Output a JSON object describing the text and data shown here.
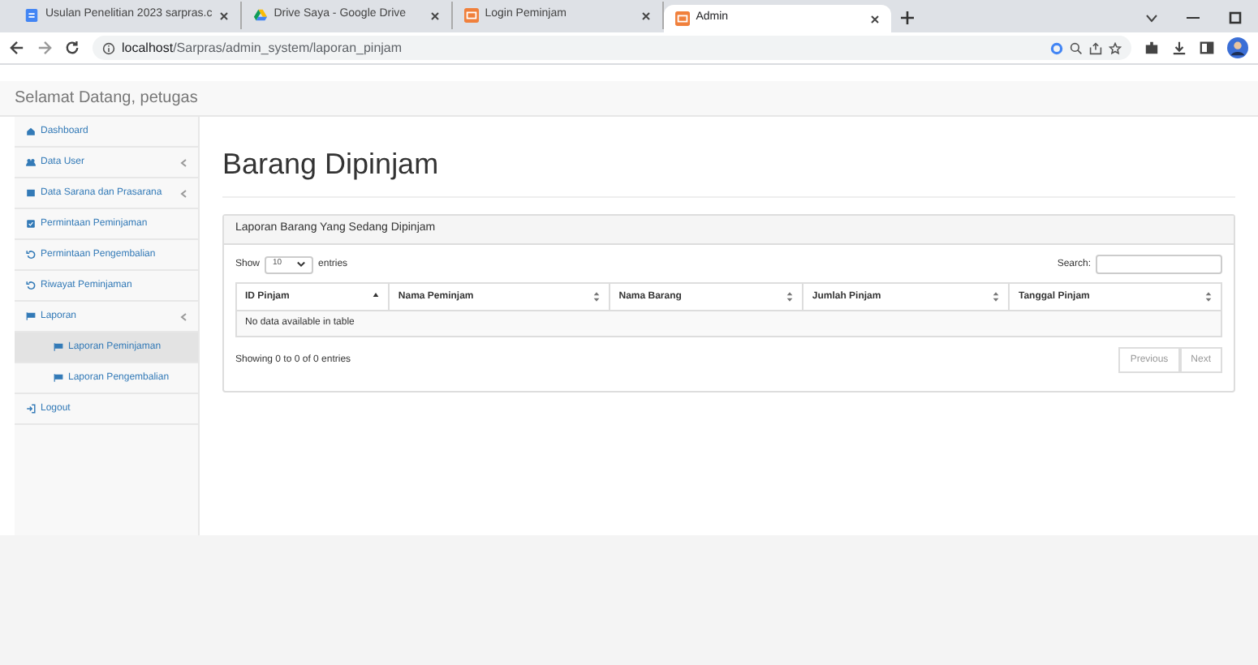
{
  "browser": {
    "tabs": [
      {
        "title": "Usulan Penelitian 2023 sarpras.c",
        "selected": false
      },
      {
        "title": "Drive Saya - Google Drive",
        "selected": false
      },
      {
        "title": "Login Peminjam",
        "selected": false
      },
      {
        "title": "Admin",
        "selected": true
      }
    ],
    "url_host": "localhost",
    "url_path": "/Sarpras/admin_system/laporan_pinjam"
  },
  "header": {
    "greeting": "Selamat Datang, petugas"
  },
  "sidebar": {
    "items": [
      {
        "label": "Dashboard",
        "expandable": false,
        "selected": false
      },
      {
        "label": "Data User",
        "expandable": true,
        "selected": false
      },
      {
        "label": "Data Sarana dan Prasarana",
        "expandable": true,
        "selected": false
      },
      {
        "label": "Permintaan Peminjaman",
        "expandable": false,
        "selected": false
      },
      {
        "label": "Permintaan Pengembalian",
        "expandable": false,
        "selected": false
      },
      {
        "label": "Riwayat Peminjaman",
        "expandable": false,
        "selected": false
      },
      {
        "label": "Laporan",
        "expandable": true,
        "selected": false,
        "children": [
          {
            "label": "Laporan Peminjaman",
            "selected": true
          },
          {
            "label": "Laporan Pengembalian",
            "selected": false
          }
        ]
      },
      {
        "label": "Logout",
        "expandable": false,
        "selected": false
      }
    ]
  },
  "page": {
    "title": "Barang Dipinjam",
    "panel_title": "Laporan Barang Yang Sedang Dipinjam",
    "show_label": "Show",
    "page_size": "10",
    "entries_label": "entries",
    "search_label": "Search:",
    "table": {
      "columns": [
        {
          "label": "ID Pinjam",
          "sorted": true
        },
        {
          "label": "Nama Peminjam",
          "sorted": false
        },
        {
          "label": "Nama Barang",
          "sorted": false
        },
        {
          "label": "Jumlah Pinjam",
          "sorted": false
        },
        {
          "label": "Tanggal Pinjam",
          "sorted": false
        }
      ],
      "empty_message": "No data available in table"
    },
    "info": "Showing 0 to 0 of 0 entries",
    "pager": [
      {
        "label": "Previous",
        "disabled": true
      },
      {
        "label": "Next",
        "disabled": true
      }
    ]
  }
}
